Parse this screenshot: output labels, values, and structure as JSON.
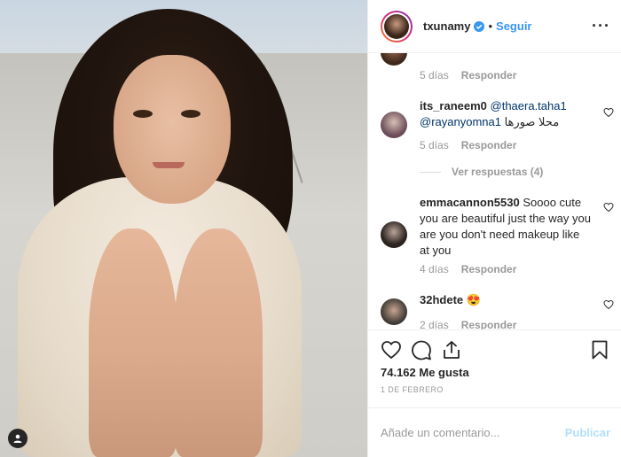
{
  "post": {
    "username": "txunamy",
    "separator": "•",
    "follow_label": "Seguir",
    "more_label": "···"
  },
  "comments": [
    {
      "partial": true,
      "time": "5 días",
      "reply_label": "Responder"
    },
    {
      "username": "its_raneem0",
      "mention1": "@thaera.taha1",
      "mention2": "@rayanyomna1",
      "text": "محلا صورها",
      "time": "5 días",
      "reply_label": "Responder",
      "view_replies": "Ver respuestas (4)"
    },
    {
      "username": "emmacannon5530",
      "text": "Soooo cute you are beautiful just the way you are you don't need makeup like at you",
      "time": "4 días",
      "reply_label": "Responder"
    },
    {
      "username": "32hdete",
      "emoji": "😍",
      "time": "2 días",
      "reply_label": "Responder"
    }
  ],
  "stats": {
    "likes": "74.162 Me gusta",
    "date": "1 DE FEBRERO"
  },
  "comment_box": {
    "placeholder": "Añade un comentario...",
    "publish_label": "Publicar"
  },
  "colors": {
    "link_blue": "#3897f0",
    "publish_disabled": "#b2dffc",
    "muted_text": "#999999"
  },
  "icons": [
    "user-tag-icon",
    "verified-badge-icon",
    "more-options-icon",
    "heart-icon",
    "comment-icon",
    "share-icon",
    "bookmark-icon"
  ]
}
